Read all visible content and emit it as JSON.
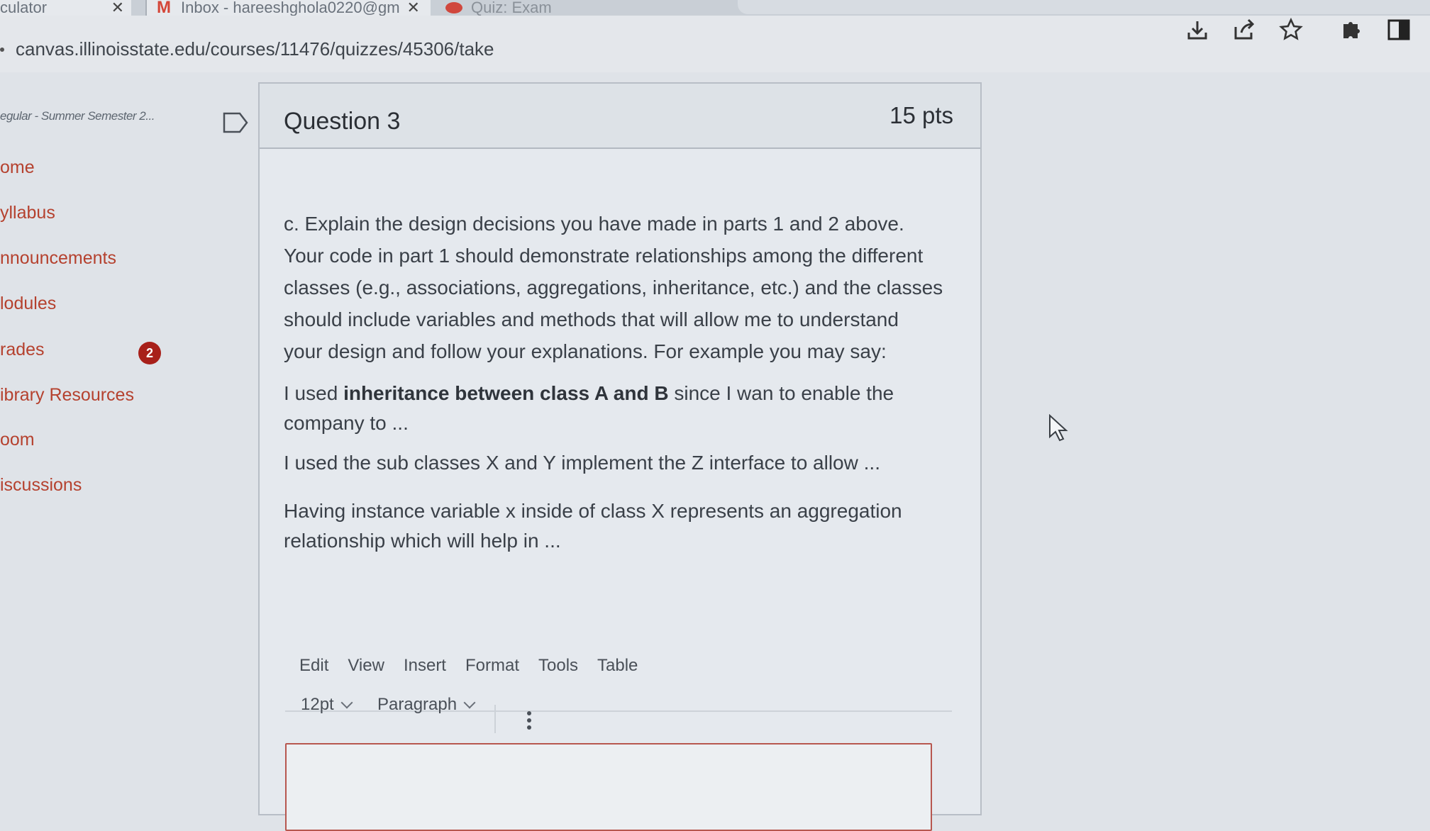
{
  "browser": {
    "tabs": [
      {
        "title": "culator",
        "close": "✕"
      },
      {
        "title": "Inbox - hareeshghola0220@gm",
        "close": "✕",
        "icon": "M"
      },
      {
        "title": "Quiz: Exam",
        "icon": "canvas-icon"
      }
    ],
    "url": "canvas.illinoisstate.edu/courses/11476/quizzes/45306/take",
    "toolbar_icons": [
      "download-icon",
      "share-icon",
      "star-icon",
      "extensions-icon",
      "sidepanel-icon"
    ]
  },
  "sidebar": {
    "term": "egular - Summer Semester 2...",
    "items": [
      {
        "label": "ome"
      },
      {
        "label": "yllabus"
      },
      {
        "label": "nnouncements"
      },
      {
        "label": "lodules"
      },
      {
        "label": "rades",
        "badge": "2"
      },
      {
        "label": "ibrary Resources"
      },
      {
        "label": "oom"
      },
      {
        "label": "iscussions"
      }
    ]
  },
  "question": {
    "title": "Question 3",
    "points": "15 pts",
    "prompt": [
      "c. Explain the design decisions you have made in parts 1 and 2 above.",
      "Your code in part 1 should demonstrate relationships among the different",
      "classes (e.g., associations, aggregations, inheritance, etc.) and the classes",
      "should include variables and methods that will allow me to understand",
      "your design and follow your explanations. For example you may say:"
    ],
    "example1_prefix": "I used ",
    "example1_bold": "inheritance between class A and B",
    "example1_suffix": " since I wan to enable the",
    "example1_line2": "company to ...",
    "example2": "I used the sub classes X and Y implement the Z interface to allow ...",
    "example3_line1": "Having instance variable x inside of class X represents an aggregation",
    "example3_line2": "relationship which will help in ..."
  },
  "editor": {
    "menu": [
      "Edit",
      "View",
      "Insert",
      "Format",
      "Tools",
      "Table"
    ],
    "font_size": "12pt",
    "block_format": "Paragraph",
    "more_icon": "vertical-dots-icon",
    "answer": ""
  },
  "colors": {
    "nav_link": "#b5412e",
    "badge": "#a8201a",
    "editor_border": "#b7574f"
  }
}
